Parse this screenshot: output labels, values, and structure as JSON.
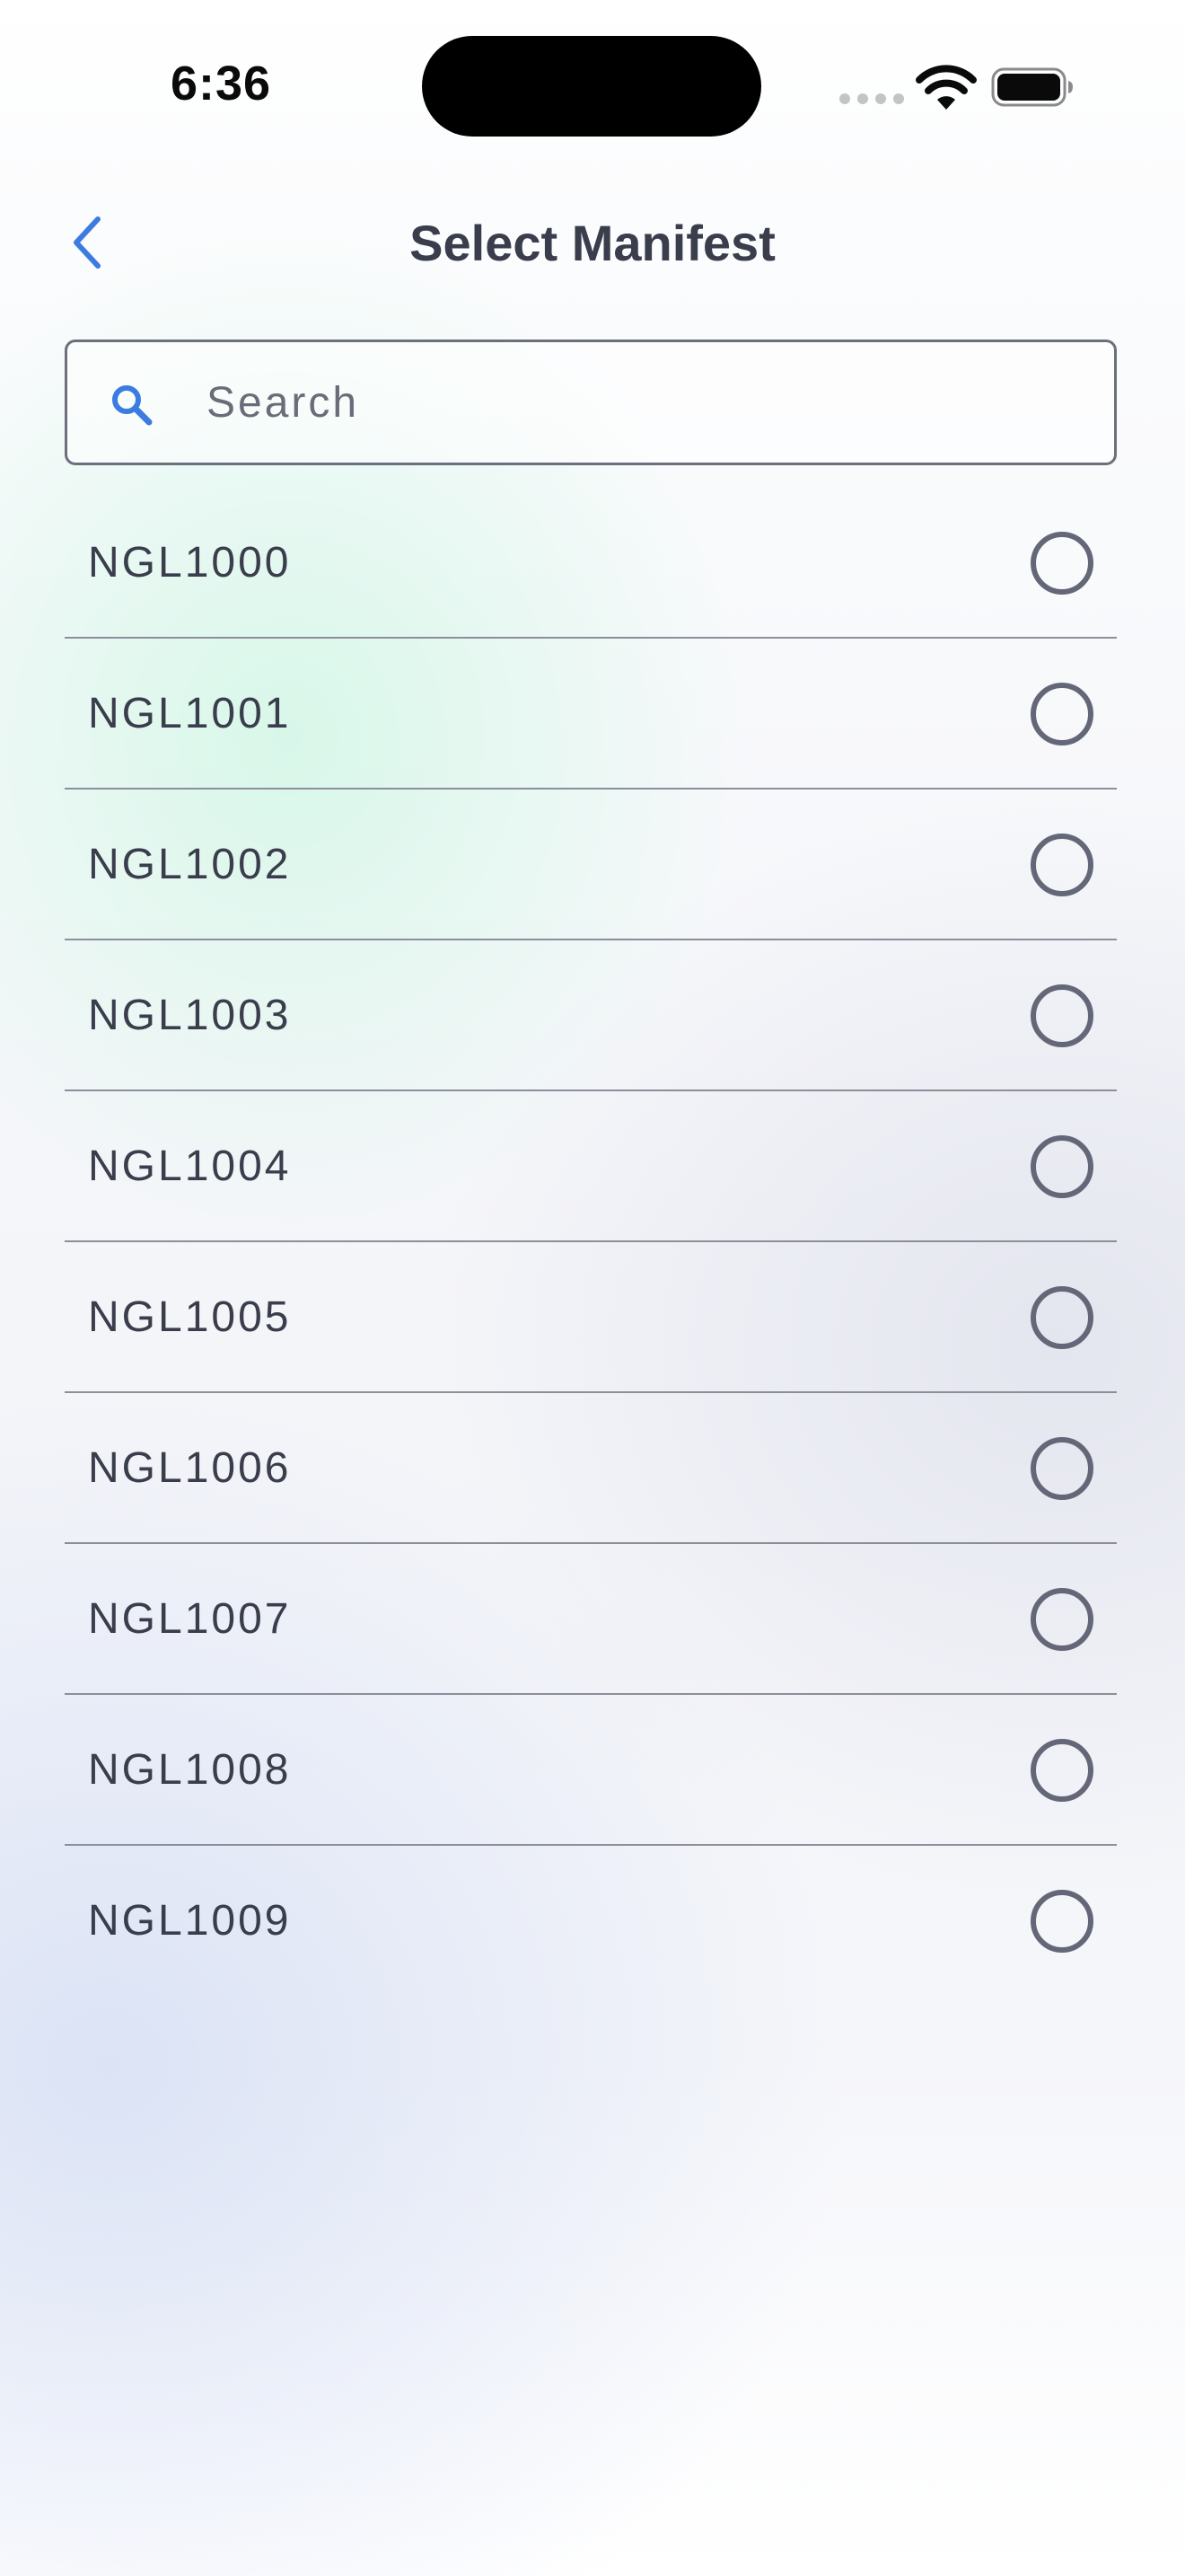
{
  "status_bar": {
    "time": "6:36"
  },
  "header": {
    "title": "Select Manifest",
    "back_icon": "chevron-left-icon"
  },
  "search": {
    "placeholder": "Search",
    "value": "",
    "icon": "search-icon"
  },
  "manifests": [
    {
      "label": "NGL1000",
      "selected": false
    },
    {
      "label": "NGL1001",
      "selected": false
    },
    {
      "label": "NGL1002",
      "selected": false
    },
    {
      "label": "NGL1003",
      "selected": false
    },
    {
      "label": "NGL1004",
      "selected": false
    },
    {
      "label": "NGL1005",
      "selected": false
    },
    {
      "label": "NGL1006",
      "selected": false
    },
    {
      "label": "NGL1007",
      "selected": false
    },
    {
      "label": "NGL1008",
      "selected": false
    },
    {
      "label": "NGL1009",
      "selected": false
    }
  ],
  "colors": {
    "accent": "#3c7be0",
    "text": "#3a3d4b",
    "radio_border": "#646777"
  }
}
